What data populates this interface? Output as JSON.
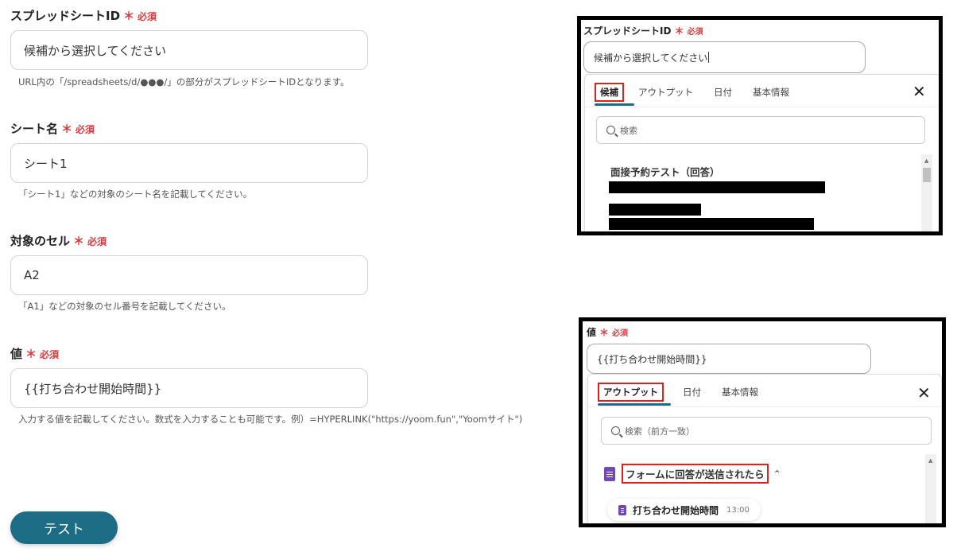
{
  "form": {
    "spreadsheet_id": {
      "label": "スプレッドシートID",
      "required": "必須",
      "placeholder": "候補から選択してください",
      "hint": "URL内の「/spreadsheets/d/●●●/」の部分がスプレッドシートIDとなります。"
    },
    "sheet_name": {
      "label": "シート名",
      "required": "必須",
      "value": "シート1",
      "hint": "「シート1」などの対象のシート名を記載してください。"
    },
    "target_cell": {
      "label": "対象のセル",
      "required": "必須",
      "value": "A2",
      "hint": "「A1」などの対象のセル番号を記載してください。"
    },
    "value": {
      "label": "値",
      "required": "必須",
      "value": "{{打ち合わせ開始時間}}",
      "hint": "入力する値を記載してください。数式を入力することも可能です。例）=HYPERLINK(\"https://yoom.fun\",\"Yoomサイト\")"
    },
    "required_star": "＊",
    "test_button": "テスト"
  },
  "panel1": {
    "label": "スプレッドシートID",
    "required": "必須",
    "input_value": "候補から選択してください",
    "tabs": [
      "候補",
      "アウトプット",
      "日付",
      "基本情報"
    ],
    "search_placeholder": "検索",
    "item_title": "面接予約テスト（回答）",
    "close": "✕"
  },
  "panel2": {
    "label": "値",
    "required": "必須",
    "input_value": "{{打ち合わせ開始時間}}",
    "tabs": [
      "アウトプット",
      "日付",
      "基本情報"
    ],
    "search_placeholder": "検索（前方一致）",
    "group_title": "フォームに回答が送信されたら",
    "chevron": "⌃",
    "item_label": "打ち合わせ開始時間",
    "item_value": "13:00",
    "close": "✕"
  },
  "colors": {
    "required_red": "#e0383b",
    "button_teal": "#1c6c86",
    "highlight_red": "#e0221f",
    "sheet_purple": "#7248b9"
  }
}
